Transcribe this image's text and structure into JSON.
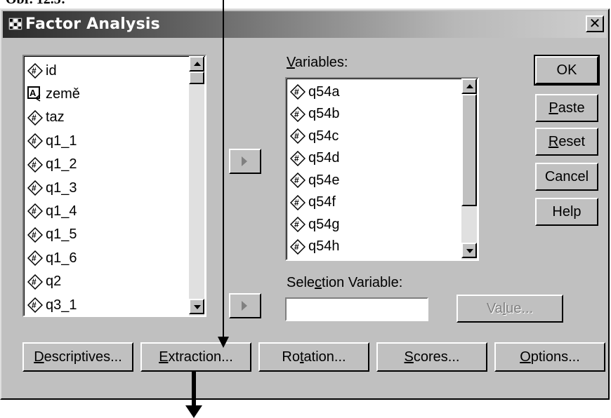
{
  "caption": "Obr. 12.5:",
  "window": {
    "title": "Factor Analysis",
    "close_glyph": "✕"
  },
  "source_list": {
    "items": [
      {
        "name": "id",
        "icon": "scale-variable-icon"
      },
      {
        "name": "země",
        "icon": "string-variable-icon"
      },
      {
        "name": "taz",
        "icon": "scale-variable-icon"
      },
      {
        "name": "q1_1",
        "icon": "scale-variable-icon"
      },
      {
        "name": "q1_2",
        "icon": "scale-variable-icon"
      },
      {
        "name": "q1_3",
        "icon": "scale-variable-icon"
      },
      {
        "name": "q1_4",
        "icon": "scale-variable-icon"
      },
      {
        "name": "q1_5",
        "icon": "scale-variable-icon"
      },
      {
        "name": "q1_6",
        "icon": "scale-variable-icon"
      },
      {
        "name": "q2",
        "icon": "scale-variable-icon"
      },
      {
        "name": "q3_1",
        "icon": "scale-variable-icon"
      }
    ]
  },
  "variables": {
    "label_first": "V",
    "label_rest": "ariables:",
    "items": [
      {
        "name": "q54a"
      },
      {
        "name": "q54b"
      },
      {
        "name": "q54c"
      },
      {
        "name": "q54d"
      },
      {
        "name": "q54e"
      },
      {
        "name": "q54f"
      },
      {
        "name": "q54g"
      },
      {
        "name": "q54h"
      }
    ]
  },
  "selection": {
    "label_pre": "Sele",
    "label_u": "c",
    "label_post": "tion Variable:",
    "value": "",
    "value_button_pre": "Va",
    "value_button_u": "l",
    "value_button_post": "ue..."
  },
  "side_buttons": {
    "ok": "OK",
    "paste_u": "P",
    "paste_rest": "aste",
    "reset_u": "R",
    "reset_rest": "eset",
    "cancel": "Cancel",
    "help": "Help"
  },
  "bottom_buttons": {
    "descriptives_u": "D",
    "descriptives_rest": "escriptives...",
    "extraction_u": "E",
    "extraction_rest": "xtraction...",
    "rotation_pre": "Ro",
    "rotation_u": "t",
    "rotation_post": "ation...",
    "scores_u": "S",
    "scores_rest": "cores...",
    "options_u": "O",
    "options_rest": "ptions..."
  }
}
